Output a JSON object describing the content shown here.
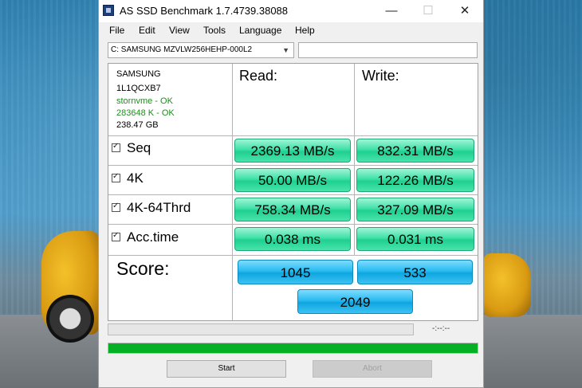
{
  "window": {
    "title": "AS SSD Benchmark 1.7.4739.38088",
    "minimize_glyph": "—",
    "maximize_glyph": "☐",
    "close_glyph": "✕"
  },
  "menu": [
    "File",
    "Edit",
    "View",
    "Tools",
    "Language",
    "Help"
  ],
  "drive": {
    "selected": "C: SAMSUNG MZVLW256HEHP-000L2",
    "dropdown_arrow": "▼",
    "extra_field_value": ""
  },
  "info": {
    "vendor": "SAMSUNG",
    "firmware": "1L1QCXB7",
    "driver_status": "stornvme - OK",
    "alignment_status": "283648 K - OK",
    "capacity": "238.47 GB",
    "ok_color": "#228b22"
  },
  "headers": {
    "read": "Read:",
    "write": "Write:"
  },
  "tests": [
    {
      "label": "Seq",
      "checked": true,
      "read": "2369.13 MB/s",
      "write": "832.31 MB/s"
    },
    {
      "label": "4K",
      "checked": true,
      "read": "50.00 MB/s",
      "write": "122.26 MB/s"
    },
    {
      "label": "4K-64Thrd",
      "checked": true,
      "read": "758.34 MB/s",
      "write": "327.09 MB/s"
    },
    {
      "label": "Acc.time",
      "checked": true,
      "read": "0.038 ms",
      "write": "0.031 ms"
    }
  ],
  "score": {
    "label": "Score:",
    "read": "1045",
    "write": "533",
    "total": "2049"
  },
  "progress": {
    "elapsed_time": "-:--:--",
    "main_fraction": 1.0,
    "fill_color": "#06b025"
  },
  "buttons": {
    "start": "Start",
    "abort": "Abort"
  },
  "colors": {
    "value_green": "#3fe0a8",
    "score_blue": "#28bbf0"
  }
}
